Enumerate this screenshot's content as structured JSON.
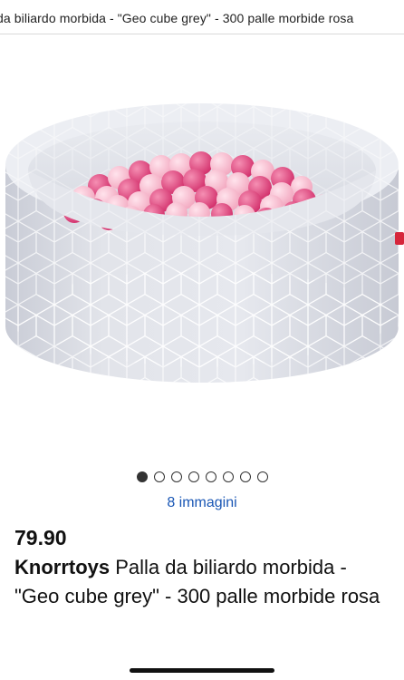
{
  "header": {
    "title": "da biliardo morbida - \"Geo cube grey\" - 300 palle morbide rosa"
  },
  "gallery": {
    "image": "pink-ball-pit-product-photo",
    "image_count": 8,
    "active_index": 0,
    "images_label": "8 immagini"
  },
  "product": {
    "price": "79.90",
    "brand": "Knorrtoys",
    "name": "Palla da biliardo morbida - \"Geo cube grey\" - 300 palle morbide rosa"
  },
  "colors": {
    "link": "#1a57b5",
    "pit": "#dfe1e7",
    "ball_pink_light": "#f6b8cc",
    "ball_pink_dark": "#e0447c"
  }
}
